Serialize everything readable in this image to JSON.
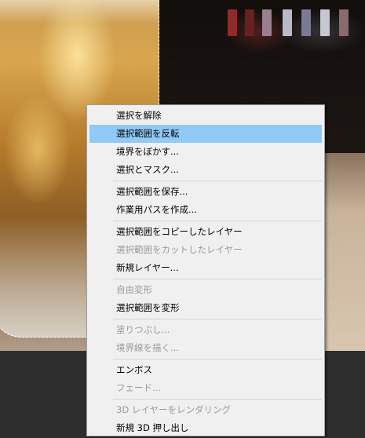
{
  "canvas": {
    "image_subject": "beer-glass-photo"
  },
  "colors": {
    "menu_background": "#f0f0f0",
    "highlight": "#91c9f7",
    "disabled_text": "#9a9a9a"
  },
  "menu": {
    "groups": [
      [
        {
          "label": "選択を解除",
          "enabled": true
        },
        {
          "label": "選択範囲を反転",
          "enabled": true,
          "highlighted": true
        },
        {
          "label": "境界をぼかす...",
          "enabled": true
        },
        {
          "label": "選択とマスク...",
          "enabled": true
        }
      ],
      [
        {
          "label": "選択範囲を保存...",
          "enabled": true
        },
        {
          "label": "作業用パスを作成...",
          "enabled": true
        }
      ],
      [
        {
          "label": "選択範囲をコピーしたレイヤー",
          "enabled": true
        },
        {
          "label": "選択範囲をカットしたレイヤー",
          "enabled": false
        },
        {
          "label": "新規レイヤー...",
          "enabled": true
        }
      ],
      [
        {
          "label": "自由変形",
          "enabled": false
        },
        {
          "label": "選択範囲を変形",
          "enabled": true
        }
      ],
      [
        {
          "label": "塗りつぶし...",
          "enabled": false
        },
        {
          "label": "境界線を描く...",
          "enabled": false
        }
      ],
      [
        {
          "label": "エンボス",
          "enabled": true
        },
        {
          "label": "フェード...",
          "enabled": false
        }
      ],
      [
        {
          "label": "3D レイヤーをレンダリング",
          "enabled": false
        },
        {
          "label": "新規 3D 押し出し",
          "enabled": true
        }
      ]
    ]
  }
}
